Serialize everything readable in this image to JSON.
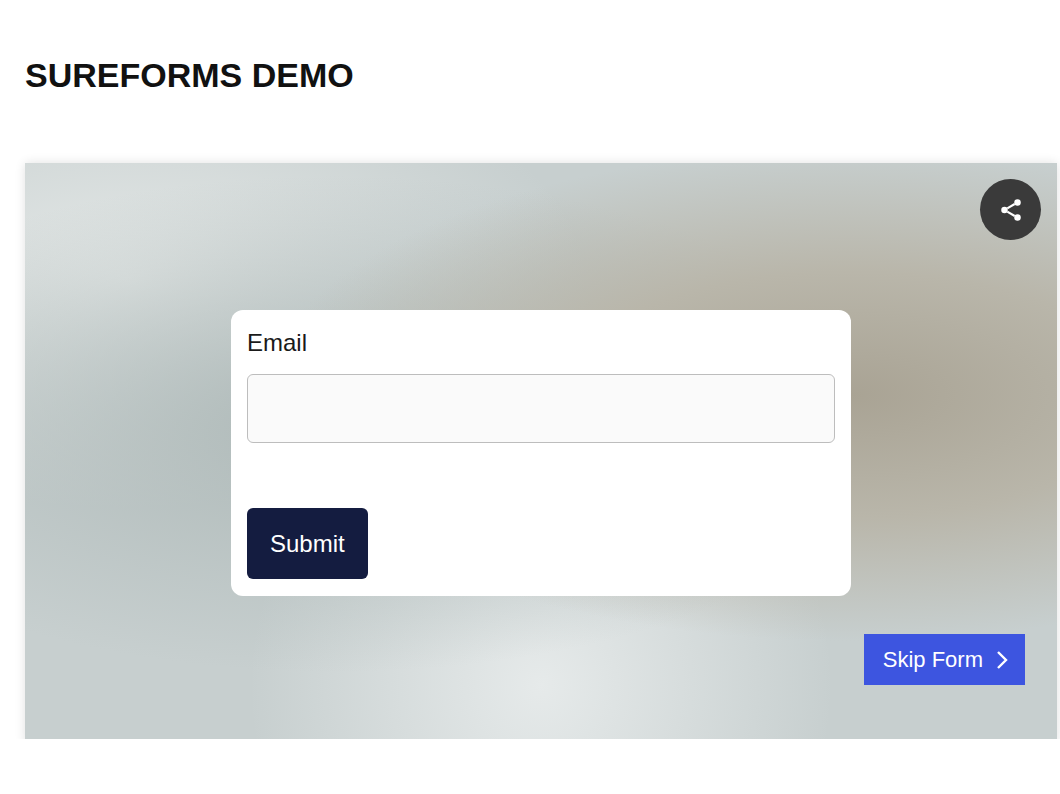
{
  "page": {
    "title": "SUREFORMS DEMO"
  },
  "form": {
    "fields": [
      {
        "label": "Email",
        "value": ""
      }
    ],
    "submit": "Submit"
  },
  "skip_button": {
    "label": "Skip Form"
  }
}
